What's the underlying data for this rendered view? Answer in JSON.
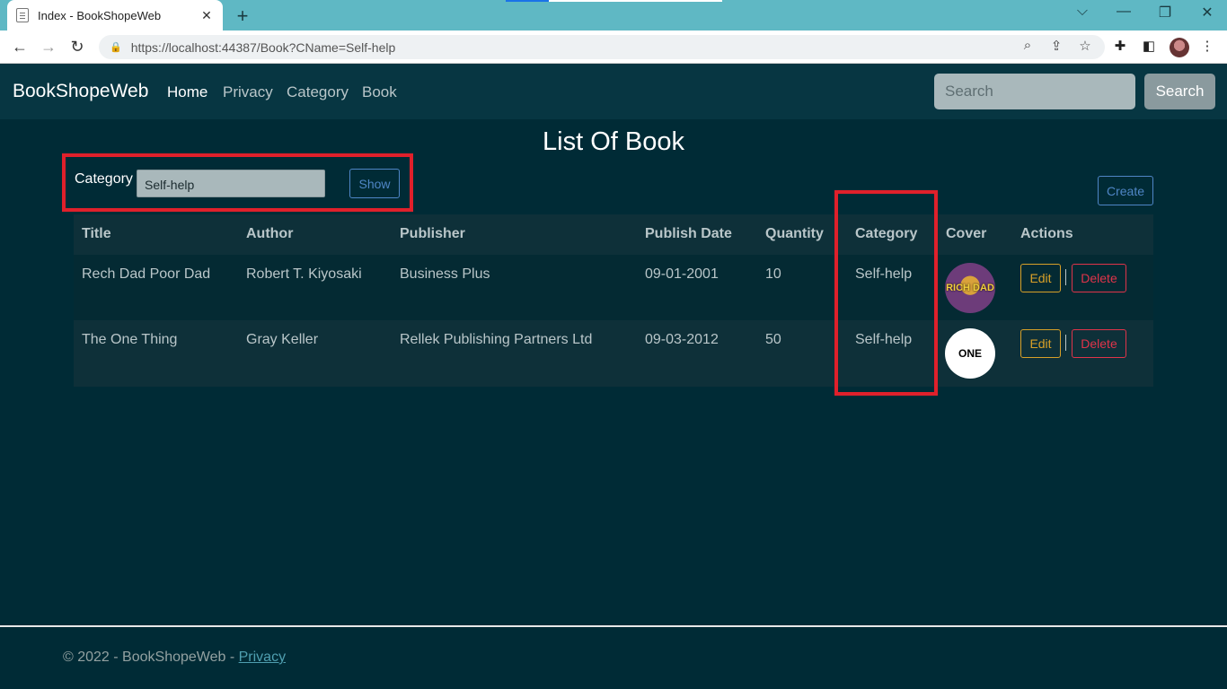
{
  "browser": {
    "tab_title": "Index - BookShopeWeb",
    "tab_close": "✕",
    "new_tab": "+",
    "url": "https://localhost:44387/Book?CName=Self-help",
    "window_controls": [
      "⌵",
      "—",
      "❐",
      "✕"
    ]
  },
  "navbar": {
    "brand": "BookShopeWeb",
    "links": [
      "Home",
      "Privacy",
      "Category",
      "Book"
    ],
    "search_placeholder": "Search",
    "search_button": "Search"
  },
  "page": {
    "title": "List Of Book",
    "filter": {
      "label": "Category",
      "selected": "Self-help",
      "show_button": "Show"
    },
    "create_button": "Create",
    "table": {
      "headers": [
        "Title",
        "Author",
        "Publisher",
        "Publish Date",
        "Quantity",
        "Category",
        "Cover",
        "Actions"
      ],
      "rows": [
        {
          "title": "Rech Dad Poor Dad",
          "author": "Robert T. Kiyosaki",
          "publisher": "Business Plus",
          "publish_date": "09-01-2001",
          "quantity": "10",
          "category": "Self-help",
          "cover_text": "RICH DAD",
          "edit": "Edit",
          "delete": "Delete"
        },
        {
          "title": "The One Thing",
          "author": "Gray Keller",
          "publisher": "Rellek Publishing Partners Ltd",
          "publish_date": "09-03-2012",
          "quantity": "50",
          "category": "Self-help",
          "cover_text": "ONE",
          "edit": "Edit",
          "delete": "Delete"
        }
      ]
    }
  },
  "footer": {
    "text": "© 2022 - BookShopeWeb - ",
    "link": "Privacy"
  }
}
